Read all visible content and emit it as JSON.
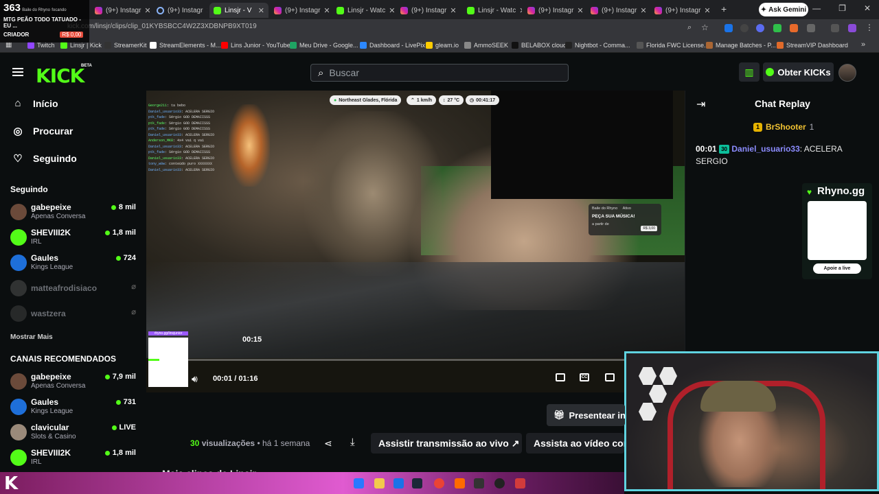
{
  "browser": {
    "tabs": [
      {
        "label": "MTG PEÃO TODO TATUADO - EU ...",
        "icon": "kick-icon",
        "active": false
      },
      {
        "label": "(9+) Instagr",
        "icon": "instagram-icon",
        "active": false
      },
      {
        "label": "(9+) Instagr",
        "icon": "loading-icon",
        "active": false
      },
      {
        "label": "Linsjr - V",
        "icon": "kick-icon",
        "active": true
      },
      {
        "label": "(9+) Instagr",
        "icon": "instagram-icon",
        "active": false
      },
      {
        "label": "Linsjr - Watc",
        "icon": "kick-icon",
        "active": false
      },
      {
        "label": "(9+) Instagr",
        "icon": "instagram-icon",
        "active": false
      },
      {
        "label": "Linsjr - Watc",
        "icon": "kick-icon",
        "active": false
      },
      {
        "label": "(9+) Instagr",
        "icon": "instagram-icon",
        "active": false
      },
      {
        "label": "(9+) Instagr",
        "icon": "instagram-icon",
        "active": false
      },
      {
        "label": "(9+) Instagr",
        "icon": "instagram-icon",
        "active": false
      }
    ],
    "new_tab": "+",
    "ask_gemini": "Ask Gemini",
    "url": "kick.com/linsjr/clips/clip_01KYBSBCC4W2Z3XDBNPB9XT019",
    "bookmarks": [
      "Twitch",
      "Linsjr | Kick",
      "StreamerKit",
      "StreamElements - M...",
      "Lins Junior - YouTube",
      "Meu Drive - Google...",
      "Dashboard - LivePix",
      "gleam.io",
      "AmmoSEEK",
      "BELABOX cloud",
      "Nightbot - Comma...",
      "Florida FWC License...",
      "Manage Batches - P...",
      "StreamVIP Dashboard"
    ]
  },
  "stream_overlay": {
    "count": "363",
    "streamer": "Baile do Rhyno",
    "focus": "focando",
    "label": "CRIADOR",
    "amount": "R$ 0,00"
  },
  "header": {
    "logo": "KICK",
    "beta": "BETA",
    "search_placeholder": "Buscar",
    "obter_label": "Obter KICKs"
  },
  "sidebar": {
    "nav": [
      {
        "label": "Início",
        "icon": "home-icon"
      },
      {
        "label": "Procurar",
        "icon": "compass-icon"
      },
      {
        "label": "Seguindo",
        "icon": "heart-icon"
      }
    ],
    "following_title": "Seguindo",
    "following": [
      {
        "name": "gabepeixe",
        "category": "Apenas Conversa",
        "viewers": "8 mil",
        "live": true,
        "color": "#6b4a3a"
      },
      {
        "name": "SHEVIII2K",
        "category": "IRL",
        "viewers": "1,8 mil",
        "live": true,
        "color": "#53fc18"
      },
      {
        "name": "Gaules",
        "category": "Kings League",
        "viewers": "724",
        "live": true,
        "color": "#1e6fd9"
      },
      {
        "name": "matteafrodisiaco",
        "category": "",
        "viewers": "",
        "live": false,
        "color": "#555"
      },
      {
        "name": "wastzera",
        "category": "",
        "viewers": "",
        "live": false,
        "color": "#444"
      }
    ],
    "show_more": "Mostrar Mais",
    "recommended_title": "CANAIS RECOMENDADOS",
    "recommended": [
      {
        "name": "gabepeixe",
        "category": "Apenas Conversa",
        "viewers": "7,9 mil",
        "color": "#6b4a3a"
      },
      {
        "name": "Gaules",
        "category": "Kings League",
        "viewers": "731",
        "color": "#1e6fd9"
      },
      {
        "name": "clavicular",
        "category": "Slots & Casino",
        "viewers": "LIVE",
        "color": "#9a8a7a"
      },
      {
        "name": "SHEVIII2K",
        "category": "IRL",
        "viewers": "1,8 mil",
        "color": "#53fc18"
      }
    ]
  },
  "video": {
    "location": "Northeast Glades, Flórida",
    "speed": "1 km/h",
    "temp": "27 °C",
    "uptime": "00:41:17",
    "hover_time": "00:15",
    "current_time": "00:01",
    "duration": "01:16",
    "progress_fraction": 0.013,
    "chat_overlay": [
      {
        "user": "George211",
        "msg": "ta bebo"
      },
      {
        "user": "Daniel_usuario33",
        "msg": "ACELERA SERGIO"
      },
      {
        "user": "ptk_fade",
        "msg": "Sérgio GOD DEMAIISSS"
      },
      {
        "user": "ptk_fade",
        "msg": "Sérgio GOD DEMAIISSS"
      },
      {
        "user": "ptk_fade",
        "msg": "Sérgio GOD DEMAIISSS"
      },
      {
        "user": "Daniel_usuario33",
        "msg": "ACELERA SERGIO"
      },
      {
        "user": "Anderson_MK8",
        "msg": "4x4 vai q vai"
      },
      {
        "user": "Daniel_usuario33",
        "msg": "ACELERA SERGIO"
      },
      {
        "user": "ptk_fade",
        "msg": "Sérgio GOD DEMAIISSS"
      },
      {
        "user": "Daniel_usuario33",
        "msg": "ACELERA SERGIO"
      },
      {
        "user": "tony_w0w",
        "msg": "conteúdo puro XXXXXXX"
      },
      {
        "user": "Daniel_usuario33",
        "msg": "ACELERA SERGIO"
      }
    ],
    "music_card": {
      "title": "Baile do Rhyno",
      "tag": "Ativo",
      "cta": "PEÇA SUA MÚSICA!",
      "from": "a partir de",
      "price": "R$ 3,00"
    },
    "qr_label": "rhyno.gg/linsjunior"
  },
  "chat": {
    "title": "Chat Replay",
    "pinned_user": "BrShooter",
    "pinned_count": "1",
    "message": {
      "time": "00:01",
      "badge": "30",
      "user": "Daniel_usuario33",
      "text": "ACELERA SERGIO"
    },
    "rhyno_title": "Rhyno.gg",
    "rhyno_button": "Apoie a live"
  },
  "below": {
    "presentear": "Presentear in",
    "views_count": "30",
    "views_label": "visualizações",
    "ago": "• há 1 semana",
    "live_button": "Assistir transmissão ao vivo",
    "vod_button": "Assista ao vídeo con",
    "more_clips": "Mais clipes de Linsjr"
  }
}
